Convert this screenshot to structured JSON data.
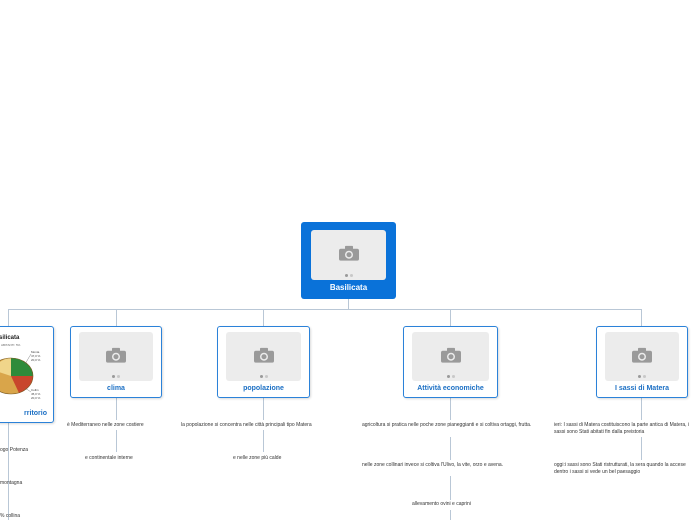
{
  "root": {
    "title": "Basilicata"
  },
  "territorio": {
    "title": "Territorio",
    "visible_title": "rritorio",
    "map_title": "silicata",
    "map_subtitle": "ABITANTI: 5%",
    "map_label_montagna": [
      "Monta",
      "47,0 %",
      "20,0 %"
    ],
    "map_label_collina": [
      "Collin",
      "45,0 %",
      "20,0 %"
    ],
    "leaves": [
      "ogo Potenza",
      "montagna",
      "% collina"
    ]
  },
  "clima": {
    "title": "clima",
    "leaves": [
      "è Mediterraneo nelle zone costiere",
      "e continentale interne"
    ]
  },
  "popolazione": {
    "title": "popolazione",
    "leaves": [
      "la popolazione si concentra nelle città principali tipo Matera",
      "e nelle zone più calde"
    ]
  },
  "attivita": {
    "title": "Attività economiche",
    "leaves": [
      "agricoltura si pratica nelle poche zone pianeggianti e si coltiva ortaggi, frutta.",
      "nelle zone collinari invece si coltiva l'Ulivo, la vite, orzo e avena.",
      "allevamento ovini e caprini"
    ]
  },
  "sassi": {
    "title": "I sassi di Matera",
    "leaves": [
      "ieri: I sassi di Matera costituiscono la parte antica di Matera, i sassi sono Stati abitati fin dalla preistoria",
      "oggi:i sassi sono Stati ristrutturati, la sera quando la accese dentro i sassi si vede un bel paesaggio"
    ]
  },
  "colors": {
    "root_fill": "#0a72d9",
    "node_border": "#2b82d9",
    "title_text": "#1b6fc4",
    "connector": "#b9c7d6"
  }
}
